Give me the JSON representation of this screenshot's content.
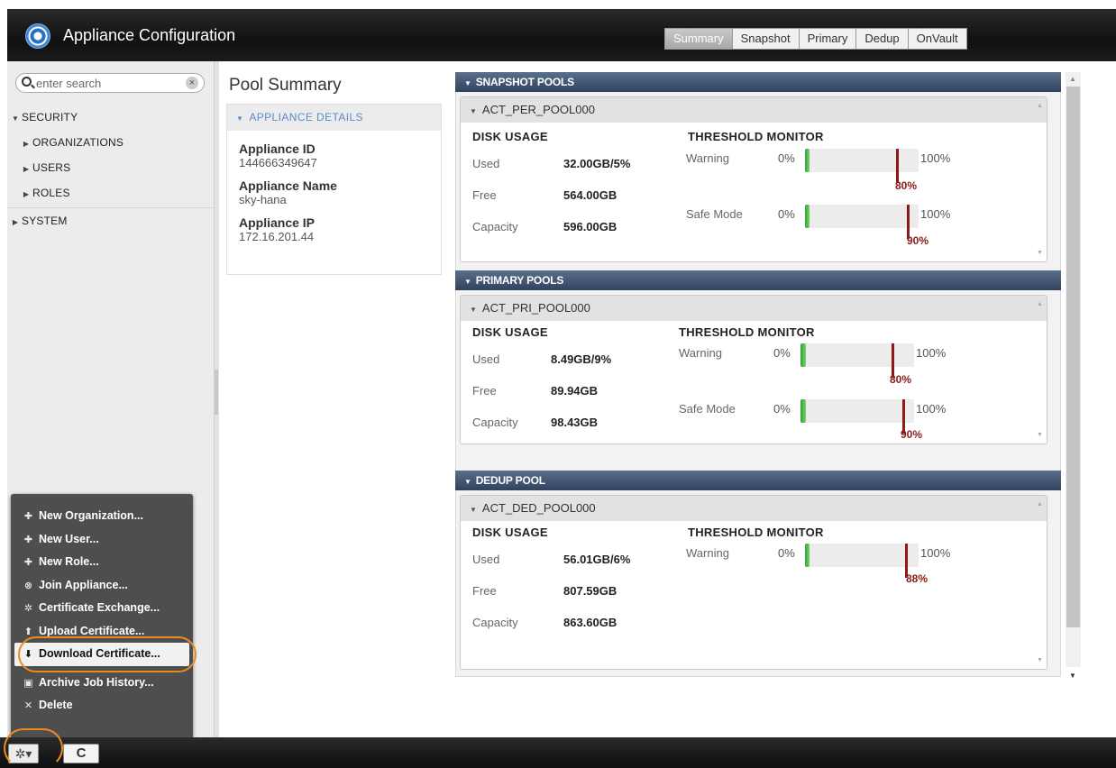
{
  "app": {
    "title": "Appliance Configuration"
  },
  "header_tabs": [
    {
      "label": "Summary",
      "active": true
    },
    {
      "label": "Snapshot",
      "active": false
    },
    {
      "label": "Primary",
      "active": false
    },
    {
      "label": "Dedup",
      "active": false
    },
    {
      "label": "OnVault",
      "active": false
    }
  ],
  "sidebar": {
    "search_placeholder": "enter search",
    "tree": [
      {
        "label": "SECURITY",
        "expanded": true,
        "level": 0
      },
      {
        "label": "ORGANIZATIONS",
        "expanded": false,
        "level": 1
      },
      {
        "label": "USERS",
        "expanded": false,
        "level": 1
      },
      {
        "label": "ROLES",
        "expanded": false,
        "level": 1
      },
      {
        "label": "SYSTEM",
        "expanded": false,
        "level": 0
      }
    ]
  },
  "context_menu": {
    "items": [
      {
        "label": "New Organization...",
        "icon": "plus-icon"
      },
      {
        "label": "New User...",
        "icon": "plus-icon"
      },
      {
        "label": "New Role...",
        "icon": "plus-icon"
      },
      {
        "label": "Join Appliance...",
        "icon": "join-icon"
      },
      {
        "label": "Certificate Exchange...",
        "icon": "gear-icon"
      },
      {
        "label": "Upload Certificate...",
        "icon": "upload-arrow-icon"
      },
      {
        "label": "Download Certificate...",
        "icon": "download-arrow-icon",
        "selected": true
      },
      {
        "label": "Archive Job History...",
        "icon": "floppy-disk-icon"
      },
      {
        "label": "Delete",
        "icon": "x-icon"
      }
    ]
  },
  "pool_summary": {
    "title": "Pool Summary",
    "appliance_details": {
      "heading": "APPLIANCE DETAILS",
      "fields": [
        {
          "label": "Appliance ID",
          "value": "144666349647"
        },
        {
          "label": "Appliance Name",
          "value": "sky-hana"
        },
        {
          "label": "Appliance IP",
          "value": "172.16.201.44"
        }
      ]
    }
  },
  "labels": {
    "disk_usage": "DISK USAGE",
    "threshold_monitor": "THRESHOLD MONITOR",
    "used": "Used",
    "free": "Free",
    "capacity": "Capacity",
    "warning": "Warning",
    "safe_mode": "Safe Mode",
    "min_pct": "0%",
    "max_pct": "100%"
  },
  "sections": [
    {
      "heading": "SNAPSHOT POOLS",
      "pool": {
        "name": "ACT_PER_POOL000",
        "used": "32.00GB/5%",
        "free": "564.00GB",
        "capacity": "596.00GB",
        "warning": {
          "fill_fraction": 0.05,
          "threshold": "80%",
          "threshold_fraction": 0.8
        },
        "safe_mode": {
          "fill_fraction": 0.05,
          "threshold": "90%",
          "threshold_fraction": 0.9
        }
      }
    },
    {
      "heading": "PRIMARY POOLS",
      "pool": {
        "name": "ACT_PRI_POOL000",
        "used": "8.49GB/9%",
        "free": "89.94GB",
        "capacity": "98.43GB",
        "warning": {
          "fill_fraction": 0.09,
          "threshold": "80%",
          "threshold_fraction": 0.8
        },
        "safe_mode": {
          "fill_fraction": 0.09,
          "threshold": "90%",
          "threshold_fraction": 0.9
        }
      }
    },
    {
      "heading": "DEDUP POOL",
      "pool": {
        "name": "ACT_DED_POOL000",
        "used": "56.01GB/6%",
        "free": "807.59GB",
        "capacity": "863.60GB",
        "warning": {
          "fill_fraction": 0.06,
          "threshold": "88%",
          "threshold_fraction": 0.88
        }
      }
    }
  ],
  "bottom_bar": {
    "gear_icon": "gear-icon",
    "refresh_label": "C"
  },
  "colors": {
    "accent_orange": "#ec8a22",
    "fill_green": "#2aa43c",
    "threshold_red": "#8b1a1a",
    "section_header": "#3b4d6a"
  }
}
